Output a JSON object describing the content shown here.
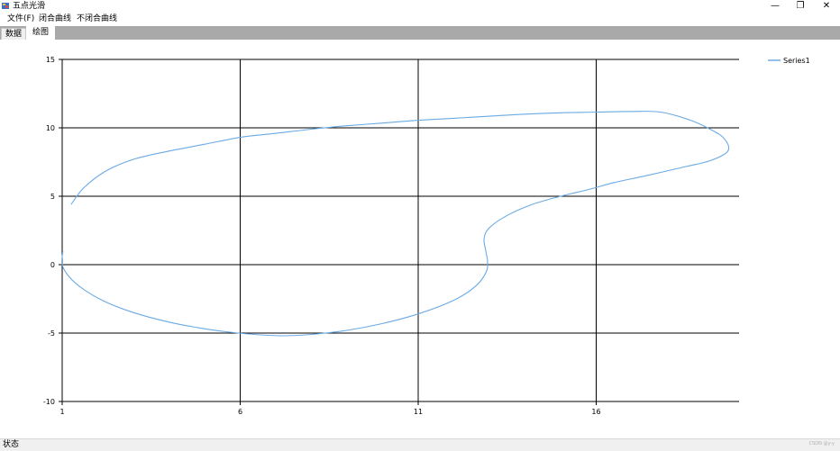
{
  "window": {
    "title": "五点光滑",
    "minimize_glyph": "—",
    "restore_glyph": "❐",
    "close_glyph": "✕"
  },
  "menu": {
    "items": [
      {
        "label": "文件(F)"
      },
      {
        "label": "闭合曲线"
      },
      {
        "label": "不闭合曲线"
      }
    ]
  },
  "tabs": [
    {
      "label": "数据"
    },
    {
      "label": "绘图"
    }
  ],
  "status": {
    "text": "状态",
    "watermark": "CSDN @y-y"
  },
  "colors": {
    "series": "#6aaae4",
    "tabstrip": "#a9a9a9",
    "grid": "#000000"
  },
  "chart_data": {
    "type": "line",
    "title": "",
    "xlabel": "",
    "ylabel": "",
    "xlim": [
      1,
      20
    ],
    "ylim": [
      -10,
      15
    ],
    "x_ticks": [
      "1",
      "6",
      "11",
      "16"
    ],
    "y_ticks": [
      "15",
      "10",
      "5",
      "0",
      "-5",
      "-10"
    ],
    "grid": true,
    "legend_position": "top-right",
    "series": [
      {
        "name": "Series1",
        "color": "#6aaae4",
        "points": [
          [
            1.25,
            4.4
          ],
          [
            1.6,
            5.6
          ],
          [
            2.2,
            6.8
          ],
          [
            3.0,
            7.7
          ],
          [
            4.0,
            8.3
          ],
          [
            5.0,
            8.8
          ],
          [
            6.0,
            9.3
          ],
          [
            7.0,
            9.6
          ],
          [
            8.0,
            9.9
          ],
          [
            9.0,
            10.15
          ],
          [
            10.0,
            10.35
          ],
          [
            11.0,
            10.55
          ],
          [
            12.0,
            10.7
          ],
          [
            13.0,
            10.85
          ],
          [
            14.0,
            11.0
          ],
          [
            15.0,
            11.1
          ],
          [
            16.0,
            11.15
          ],
          [
            17.0,
            11.2
          ],
          [
            17.8,
            11.15
          ],
          [
            18.6,
            10.6
          ],
          [
            19.2,
            9.9
          ],
          [
            19.6,
            9.2
          ],
          [
            19.7,
            8.3
          ],
          [
            19.2,
            7.6
          ],
          [
            18.4,
            7.1
          ],
          [
            17.4,
            6.5
          ],
          [
            16.5,
            6.0
          ],
          [
            15.8,
            5.5
          ],
          [
            15.0,
            5.0
          ],
          [
            14.2,
            4.4
          ],
          [
            13.5,
            3.6
          ],
          [
            13.0,
            2.7
          ],
          [
            12.85,
            1.9
          ],
          [
            12.9,
            1.0
          ],
          [
            12.95,
            0.2
          ],
          [
            12.9,
            -0.6
          ],
          [
            12.6,
            -1.6
          ],
          [
            12.0,
            -2.6
          ],
          [
            11.0,
            -3.6
          ],
          [
            10.0,
            -4.3
          ],
          [
            9.0,
            -4.8
          ],
          [
            8.0,
            -5.1
          ],
          [
            7.2,
            -5.2
          ],
          [
            6.4,
            -5.1
          ],
          [
            5.6,
            -4.9
          ],
          [
            4.8,
            -4.6
          ],
          [
            4.0,
            -4.2
          ],
          [
            3.0,
            -3.5
          ],
          [
            2.2,
            -2.7
          ],
          [
            1.6,
            -1.8
          ],
          [
            1.2,
            -0.9
          ],
          [
            1.0,
            0.0
          ],
          [
            1.02,
            1.0
          ]
        ]
      }
    ]
  }
}
